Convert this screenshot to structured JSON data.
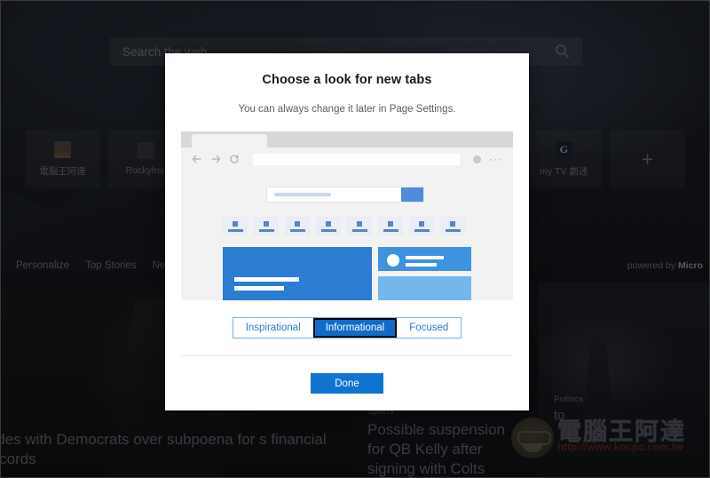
{
  "background": {
    "search": {
      "placeholder": "Search the web",
      "icon": "search-icon"
    },
    "tiles": [
      {
        "label": "電腦王阿達",
        "icon": "site-thumbnail-icon"
      },
      {
        "label": "Rockyhsu",
        "icon": "blank-favicon-icon"
      },
      {
        "label": "",
        "icon": "blank-favicon-icon"
      },
      {
        "label": "",
        "icon": "blank-favicon-icon"
      },
      {
        "label": "",
        "icon": "blank-favicon-icon"
      },
      {
        "label": "",
        "icon": "blank-favicon-icon"
      },
      {
        "label": "my TV 劇迷",
        "icon": "g-favicon-icon"
      }
    ],
    "add_tile_label": "+",
    "nav": {
      "items": [
        "Personalize",
        "Top Stories",
        "New"
      ],
      "powered_prefix": "powered by ",
      "powered_brand": "Micro"
    },
    "news": [
      {
        "category": "",
        "headline": "sides with Democrats over subpoena for s financial records"
      },
      {
        "category": "Sports",
        "headline": "Possible suspension for QB Kelly after signing with Colts"
      },
      {
        "category": "Politics",
        "headline": "to"
      }
    ],
    "watermark": {
      "text": "電腦王阿達",
      "url": "http://www.kocpc.com.tw"
    }
  },
  "modal": {
    "title": "Choose a look for new tabs",
    "subtitle": "You can always change it later in Page Settings.",
    "preview": {
      "back_icon": "back-arrow-icon",
      "forward_icon": "forward-arrow-icon",
      "refresh_icon": "refresh-icon",
      "profile_icon": "profile-dot-icon",
      "more_icon": "ellipsis-icon",
      "tile_count": 8
    },
    "layout_options": [
      {
        "label": "Inspirational",
        "selected": false
      },
      {
        "label": "Informational",
        "selected": true
      },
      {
        "label": "Focused",
        "selected": false
      }
    ],
    "done_label": "Done",
    "accent_color": "#1173d1",
    "selected_tab_color": "#0f6cc9"
  }
}
